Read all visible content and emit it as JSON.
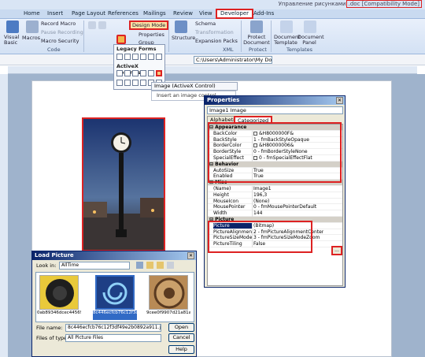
{
  "title": "Управление рисунками.doc [Compatibility Mode]",
  "title_prefix": "Управление рисунками",
  "title_highlight": ".doc [Compatibility Mode]",
  "tabs": [
    "Home",
    "Insert",
    "Page Layout",
    "References",
    "Mailings",
    "Review",
    "View",
    "Developer",
    "Add-Ins"
  ],
  "ribbon": {
    "code": {
      "visual_basic": "Visual Basic",
      "macros": "Macros",
      "record_macro": "Record Macro",
      "pause_recording": "Pause Recording",
      "macro_security": "Macro Security",
      "group": "Code"
    },
    "controls": {
      "design_mode": "Design Mode",
      "properties": "Properties",
      "group_fragment": "Group"
    },
    "xml": {
      "structure": "Structure",
      "schema": "Schema",
      "transformation": "Transformation",
      "expansion_packs": "Expansion Packs",
      "group": "XML"
    },
    "protect": {
      "protect_document": "Protect Document",
      "group": "Protect"
    },
    "templates": {
      "document_template": "Document Template",
      "document_panel": "Document Panel",
      "group": "Templates"
    }
  },
  "path_field": "C:\\Users\\Administrator\\My Docu",
  "legacy_popup": {
    "legacy_forms": "Legacy Forms",
    "activex_controls": "ActiveX Controls"
  },
  "tooltip": {
    "title": "Image (ActiveX Control)",
    "desc": "Insert an image control"
  },
  "properties": {
    "title": "Properties",
    "object": "Image1  Image",
    "tab_alphabetic": "Alphabetic",
    "tab_categorized": "Categorized",
    "rows": [
      {
        "cat": true,
        "k": "Appearance"
      },
      {
        "k": "BackColor",
        "v": "&H8000000F&",
        "sw": true
      },
      {
        "k": "BackStyle",
        "v": "1 - fmBackStyleOpaque"
      },
      {
        "k": "BorderColor",
        "v": "&H80000006&",
        "sw": true
      },
      {
        "k": "BorderStyle",
        "v": "0 - fmBorderStyleNone"
      },
      {
        "k": "SpecialEffect",
        "v": "0 - fmSpecialEffectFlat",
        "sw": true
      },
      {
        "cat": true,
        "k": "Behavior"
      },
      {
        "k": "AutoSize",
        "v": "True"
      },
      {
        "k": "Enabled",
        "v": "True"
      },
      {
        "cat": true,
        "k": "Misc"
      },
      {
        "k": "(Name)",
        "v": "Image1"
      },
      {
        "k": "Height",
        "v": "196,3"
      },
      {
        "k": "MouseIcon",
        "v": "(None)"
      },
      {
        "k": "MousePointer",
        "v": "0 - fmMousePointerDefault"
      },
      {
        "k": "Width",
        "v": "144"
      },
      {
        "cat": true,
        "k": "Picture"
      },
      {
        "k": "Picture",
        "v": "(Bitmap)",
        "sel": true
      },
      {
        "k": "PictureAlignment",
        "v": "2 - fmPictureAlignmentCenter"
      },
      {
        "k": "PictureSizeMode",
        "v": "3 - fmPictureSizeModeZoom"
      },
      {
        "k": "PictureTiling",
        "v": "False"
      }
    ],
    "ellipsis": "..."
  },
  "load_picture": {
    "title": "Load Picture",
    "look_in_label": "Look in:",
    "look_in_value": "AllTime",
    "files": [
      "0ab89346dcec44569d...",
      "8c446ecfcb76c12f3df49e2b0892a911.jpg",
      "9cee0f9907d21a81ace2..."
    ],
    "file_name_label": "File name:",
    "file_name_value": "8c446ecfcb76c12f3df49e2b0892a911.jpg",
    "files_of_type_label": "Files of type:",
    "files_of_type_value": "All Picture Files",
    "open": "Open",
    "cancel": "Cancel",
    "help": "Help"
  }
}
